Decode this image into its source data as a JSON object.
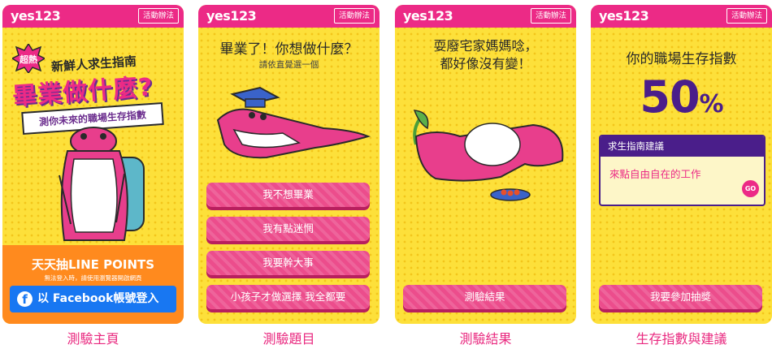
{
  "brand": {
    "logo": "yes123",
    "rules_label": "活動辦法",
    "pink": "#ec2a86",
    "yellow": "#fde03a",
    "purple": "#4a1e8a"
  },
  "screens": [
    {
      "caption": "測驗主頁",
      "hot_badge": "超熱",
      "subtitle": "新鮮人求生指南",
      "title": "畢業做什麼?",
      "ribbon": "測你未來的職場生存指數",
      "promo": "天天抽LINE POINTS",
      "note": "無法登入時，請使用瀏覽器開啟網頁",
      "login_button": "以 Facebook帳號登入"
    },
    {
      "caption": "測驗題目",
      "question": "畢業了！你想做什麼？",
      "hint": "請依直覺選一個",
      "options": [
        "我不想畢業",
        "我有點迷惘",
        "我要幹大事",
        "小孩子才做選擇 我全都要"
      ]
    },
    {
      "caption": "測驗結果",
      "result_line1": "耍廢宅家媽媽唸，",
      "result_line2": "都好像沒有變！",
      "button": "測驗結果"
    },
    {
      "caption": "生存指數與建議",
      "title": "你的職場生存指數",
      "score": "50",
      "score_unit": "%",
      "advice_header": "求生指南建議",
      "advice_text": "來點自由自在的工作",
      "go_label": "GO",
      "button": "我要參加抽獎"
    }
  ]
}
